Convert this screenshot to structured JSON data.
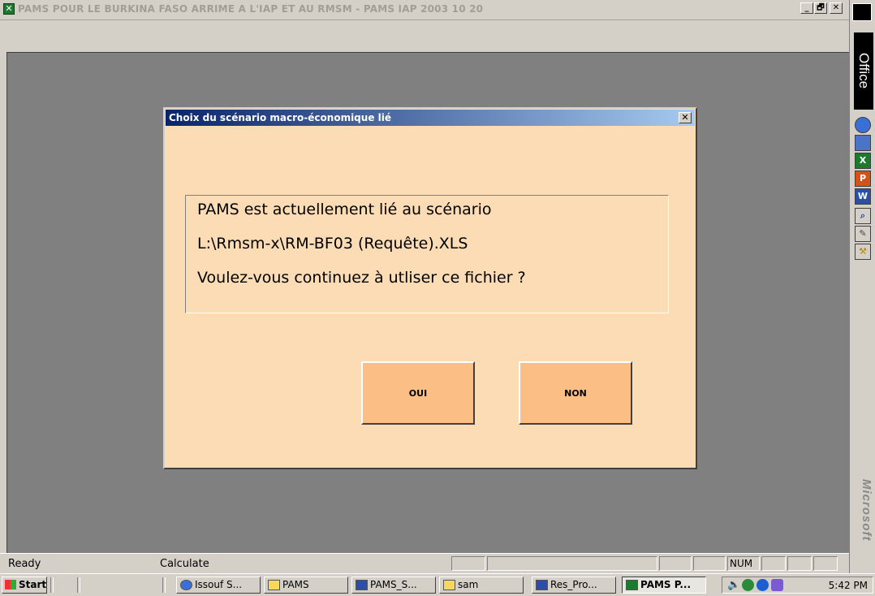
{
  "window": {
    "title": "PAMS POUR LE BURKINA FASO ARRIME A L'IAP ET AU RMSM - PAMS IAP 2003 10 20",
    "app_icon": "excel-icon",
    "minimize": "_",
    "restore": "🗗",
    "close": "✕"
  },
  "office_bar": {
    "label": "Office",
    "icons": [
      "ie-icon",
      "netscape-icon",
      "excel-icon",
      "powerpoint-icon",
      "word-icon",
      "find-icon",
      "note-icon",
      "tools-icon"
    ],
    "brand": "Microsoft"
  },
  "dialog": {
    "title": "Choix du scénario macro-économique lié",
    "close": "✕",
    "message": {
      "line1": "PAMS est actuellement lié au scénario",
      "line2": "L:\\Rmsm-x\\RM-BF03 (Requête).XLS",
      "line3": "Voulez-vous continuez à utliser ce fichier ?"
    },
    "yes_label": "OUI",
    "no_label": "NON",
    "bg_color": "#fbdcb4",
    "button_color": "#fbbf85"
  },
  "statusbar": {
    "left": "Ready",
    "mode": "Calculate",
    "num": "NUM"
  },
  "taskbar": {
    "start": "Start",
    "items": [
      {
        "label": "Issouf S...",
        "icon": "ie-icon"
      },
      {
        "label": "PAMS",
        "icon": "folder-icon"
      },
      {
        "label": "PAMS_S...",
        "icon": "word-icon"
      },
      {
        "label": "sam",
        "icon": "folder-icon"
      },
      {
        "label": "Res_Pro...",
        "icon": "word-icon"
      },
      {
        "label": "PAMS P...",
        "icon": "excel-icon",
        "active": true
      }
    ],
    "clock": "5:42 PM"
  }
}
